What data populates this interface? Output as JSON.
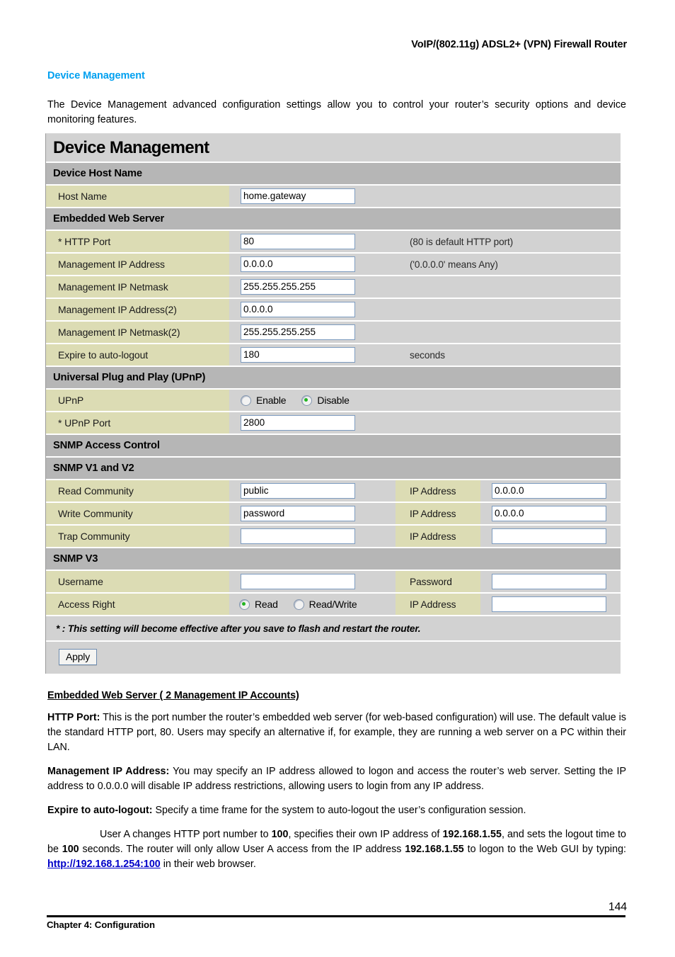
{
  "running_head": "VoIP/(802.11g) ADSL2+ (VPN) Firewall Router",
  "section_heading": "Device Management",
  "intro": "The Device Management advanced configuration settings allow you to control your router’s security options and device monitoring features.",
  "screenshot": {
    "title": "Device Management",
    "sections": {
      "host_name": {
        "header": "Device Host Name",
        "label": "Host Name",
        "value": "home.gateway"
      },
      "web_server": {
        "header": "Embedded Web Server",
        "rows": [
          {
            "label": "* HTTP Port",
            "value": "80",
            "note": "(80 is default HTTP port)"
          },
          {
            "label": "Management IP Address",
            "value": "0.0.0.0",
            "note": "('0.0.0.0' means Any)"
          },
          {
            "label": "Management IP Netmask",
            "value": "255.255.255.255",
            "note": ""
          },
          {
            "label": "Management IP Address(2)",
            "value": "0.0.0.0",
            "note": ""
          },
          {
            "label": "Management IP Netmask(2)",
            "value": "255.255.255.255",
            "note": ""
          },
          {
            "label": "Expire to auto-logout",
            "value": "180",
            "note": "seconds"
          }
        ]
      },
      "upnp": {
        "header": "Universal Plug and Play (UPnP)",
        "toggle_label": "UPnP",
        "option_enable": "Enable",
        "option_disable": "Disable",
        "selected": "Disable",
        "port_label": "* UPnP Port",
        "port_value": "2800"
      },
      "snmp_access": {
        "header": "SNMP Access Control"
      },
      "snmp_v12": {
        "header": "SNMP V1 and V2",
        "ip_label": "IP Address",
        "rows": [
          {
            "label": "Read Community",
            "value": "public",
            "ip_label": "IP Address",
            "ip_value": "0.0.0.0"
          },
          {
            "label": "Write Community",
            "value": "password",
            "ip_label": "IP Address",
            "ip_value": "0.0.0.0"
          },
          {
            "label": "Trap Community",
            "value": "",
            "ip_label": "IP Address",
            "ip_value": ""
          }
        ]
      },
      "snmp_v3": {
        "header": "SNMP V3",
        "username_label": "Username",
        "username_value": "",
        "password_label": "Password",
        "password_value": "",
        "access_right_label": "Access Right",
        "option_read": "Read",
        "option_readwrite": "Read/Write",
        "selected": "Read",
        "ip_label": "IP Address",
        "ip_value": ""
      }
    },
    "footnote": "* : This setting will become effective after you save to flash and restart the router.",
    "apply_label": "Apply"
  },
  "body": {
    "sub_heading": "Embedded Web Server ( 2 Management IP Accounts)",
    "p1_lead": "HTTP Port:",
    "p1_text": " This is the port number the router’s embedded web server (for web-based configuration) will use. The default value is the standard HTTP port, 80. Users may specify an alternative if, for example, they are running a web server on a PC within their LAN.",
    "p2_lead": "Management IP Address:",
    "p2_text": " You may specify an IP address allowed to logon and access the router’s web server. Setting the IP address to 0.0.0.0 will disable IP address restrictions, allowing users to login from any IP address.",
    "p3_lead": "Expire to auto-logout:",
    "p3_text": " Specify a time frame for the system to auto-logout the user’s configuration session.",
    "p4_a": "User A changes HTTP port number to ",
    "p4_b1": "100",
    "p4_c": ", specifies their own IP address of ",
    "p4_b2": "192.168.1.55",
    "p4_d": ", and sets the logout time to be ",
    "p4_b3": "100",
    "p4_e": " seconds.  The router will only allow User A access from the IP address ",
    "p4_b4": "192.168.1.55",
    "p4_f": " to logon to the Web GUI by typing: ",
    "p4_link_plain": "http://",
    "p4_link_bold": "192.168.1.254:100",
    "p4_g": " in their web browser."
  },
  "footer": {
    "chapter": "Chapter 4: Configuration",
    "page_number": "144"
  },
  "colors": {
    "accent_heading": "#00A0F0",
    "panel_bg": "#d2d2d2",
    "section_header_bg": "#b6b6b6",
    "label_cell_bg": "#dcdcb4",
    "input_border": "#7d9cc0",
    "radio_dot": "#22b422",
    "link": "#0000c8"
  }
}
